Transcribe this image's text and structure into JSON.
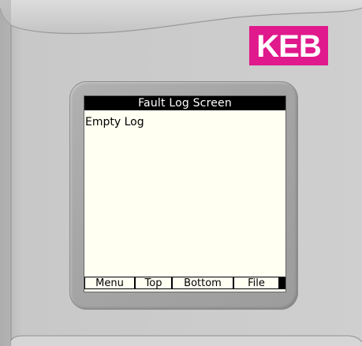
{
  "device": {
    "logo_text": "KEB",
    "logo_color": "#e0198c",
    "casing_color": "#c9c9c9"
  },
  "screen": {
    "title": "Fault Log Screen",
    "body_text": "Empty Log",
    "background_color": "#fffff2"
  },
  "menu": {
    "items": [
      {
        "label": "Menu"
      },
      {
        "label": "Top"
      },
      {
        "label": "Bottom"
      },
      {
        "label": "File"
      }
    ]
  }
}
